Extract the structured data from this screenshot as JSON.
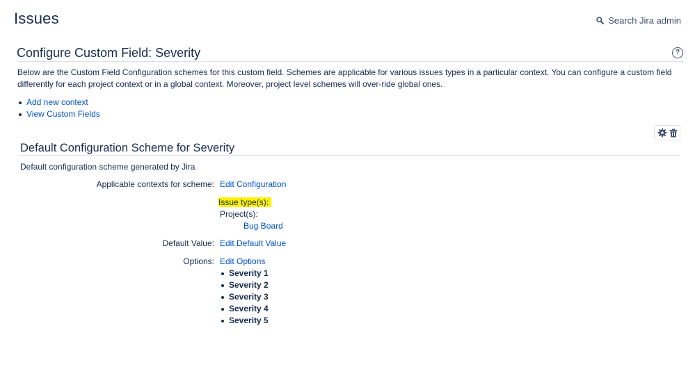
{
  "page": {
    "title": "Issues",
    "search_label": "Search Jira admin"
  },
  "field": {
    "title": "Configure Custom Field: Severity",
    "help_symbol": "?",
    "description": "Below are the Custom Field Configuration schemes for this custom field. Schemes are applicable for various issues types in a particular context. You can configure a custom field differently for each project context or in a global context. Moreover, project level schemes will over-ride global ones.",
    "links": [
      {
        "label": "Add new context"
      },
      {
        "label": "View Custom Fields"
      }
    ]
  },
  "scheme": {
    "title": "Default Configuration Scheme for Severity",
    "description": "Default configuration scheme generated by Jira",
    "contexts_label": "Applicable contexts for scheme:",
    "edit_configuration": "Edit Configuration",
    "issue_types_label": "Issue type(s):",
    "projects_label": "Project(s):",
    "project_name": "Bug Board",
    "default_value_label": "Default Value:",
    "edit_default_value": "Edit Default Value",
    "options_label": "Options:",
    "edit_options": "Edit Options",
    "options": [
      "Severity 1",
      "Severity 2",
      "Severity 3",
      "Severity 4",
      "Severity 5"
    ]
  },
  "colors": {
    "link": "#0052cc",
    "text": "#172b4d",
    "highlight": "#fff200"
  }
}
